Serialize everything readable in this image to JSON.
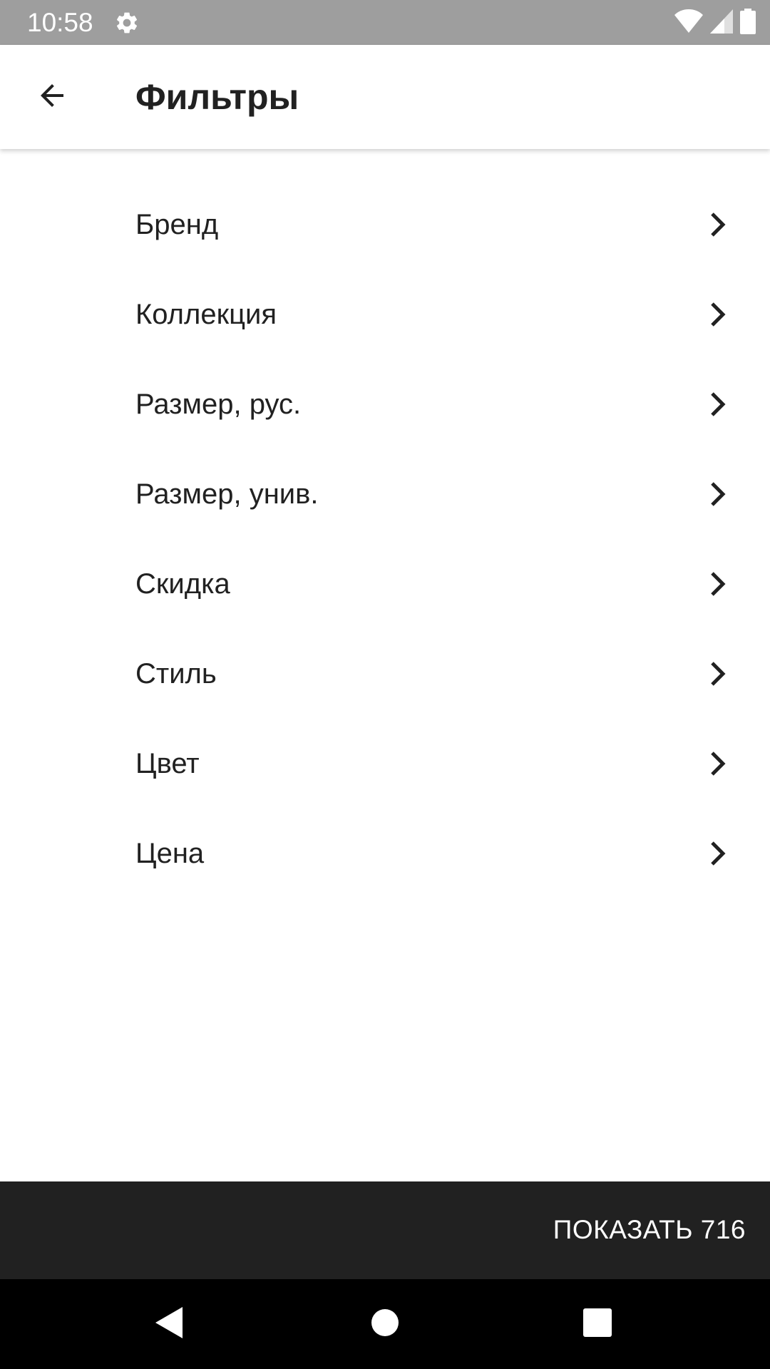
{
  "status_bar": {
    "time": "10:58",
    "icons": [
      "gear-icon",
      "wifi-icon",
      "cell-signal-icon",
      "battery-icon"
    ]
  },
  "app_bar": {
    "title": "Фильтры",
    "back_icon": "arrow-back-icon"
  },
  "filters": [
    {
      "label": "Бренд"
    },
    {
      "label": "Коллекция"
    },
    {
      "label": "Размер, рус."
    },
    {
      "label": "Размер, унив."
    },
    {
      "label": "Скидка"
    },
    {
      "label": "Стиль"
    },
    {
      "label": "Цвет"
    },
    {
      "label": "Цена"
    }
  ],
  "action": {
    "label": "ПОКАЗАТЬ 716"
  },
  "nav_bar": {
    "icons": [
      "nav-back-icon",
      "nav-home-icon",
      "nav-recents-icon"
    ]
  },
  "colors": {
    "status_bar": "#9e9e9e",
    "text_primary": "#212121",
    "action_bar": "#212121",
    "nav_bar": "#000000"
  }
}
